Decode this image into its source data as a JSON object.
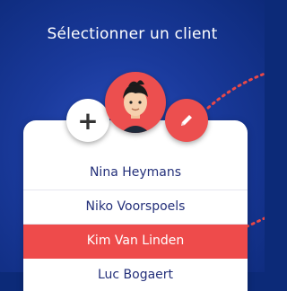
{
  "header": {
    "title": "Sélectionner un client"
  },
  "actions": {
    "add_icon": "plus-icon",
    "add_symbol": "+",
    "avatar_icon": "user-avatar-icon",
    "edit_icon": "pencil-icon"
  },
  "clients": [
    {
      "name": "Nina Heymans",
      "selected": false
    },
    {
      "name": "Niko Voorspoels",
      "selected": false
    },
    {
      "name": "Kim Van Linden",
      "selected": true
    },
    {
      "name": "Luc Bogaert",
      "selected": false
    }
  ],
  "colors": {
    "background": "#1a3a9c",
    "accent": "#ec4f4f",
    "text_primary": "#24307a",
    "selected_row": "#ee4b4b"
  }
}
